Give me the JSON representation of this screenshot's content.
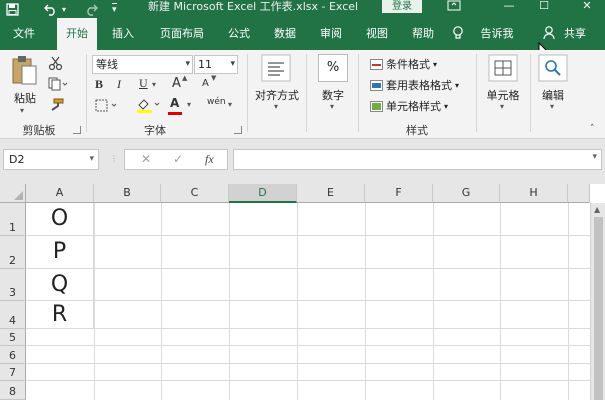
{
  "window": {
    "title": "新建 Microsoft Excel 工作表.xlsx  -  Excel",
    "login_label": "登录",
    "min_symbol": "—",
    "max_symbol": "☐",
    "close_symbol": "✕"
  },
  "quick_access": {
    "save_icon": "save-icon",
    "undo_icon": "undo-icon",
    "redo_icon": "redo-icon",
    "customize_icon": "customize-icon"
  },
  "tabs": [
    {
      "label": "文件"
    },
    {
      "label": "开始"
    },
    {
      "label": "插入"
    },
    {
      "label": "页面布局"
    },
    {
      "label": "公式"
    },
    {
      "label": "数据"
    },
    {
      "label": "审阅"
    },
    {
      "label": "视图"
    },
    {
      "label": "帮助"
    },
    {
      "label": "告诉我"
    },
    {
      "label": "共享"
    }
  ],
  "ribbon": {
    "clipboard": {
      "paste_label": "粘贴",
      "group_label": "剪贴板"
    },
    "font": {
      "font_name": "等线",
      "font_size": "11",
      "bold": "B",
      "italic": "I",
      "underline": "U",
      "grow": "A",
      "shrink": "A",
      "font_color": "A",
      "phonetic": "wén",
      "group_label": "字体"
    },
    "alignment": {
      "label": "对齐方式"
    },
    "number": {
      "label": "数字",
      "percent": "%"
    },
    "styles": {
      "conditional": "条件格式",
      "table": "套用表格格式",
      "cell_styles": "单元格样式",
      "group_label": "样式"
    },
    "cells": {
      "label": "单元格"
    },
    "editing": {
      "label": "编辑"
    }
  },
  "formula_bar": {
    "name_box": "D2",
    "cancel": "✕",
    "enter": "✓",
    "fx": "fx",
    "formula": ""
  },
  "grid": {
    "columns": [
      "A",
      "B",
      "C",
      "D",
      "E",
      "F",
      "G",
      "H"
    ],
    "rows": [
      "1",
      "2",
      "3",
      "4",
      "5",
      "6",
      "7",
      "8"
    ],
    "selected_column": "D",
    "values": {
      "A1": "O",
      "A2": "P",
      "A3": "Q",
      "A4": "R"
    }
  },
  "colors": {
    "accent": "#217346",
    "ribbon": "#f3f3f3",
    "chrome": "#e6e6e6"
  }
}
